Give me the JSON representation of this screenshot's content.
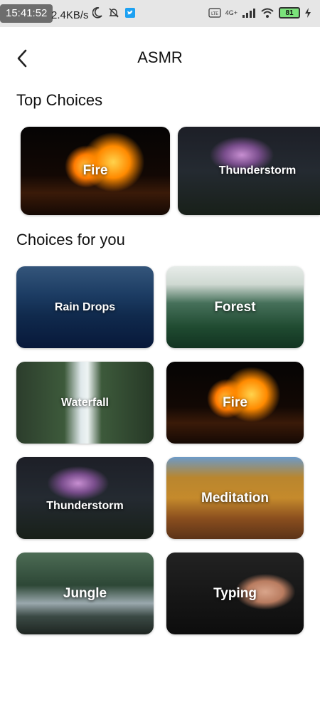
{
  "status_bar": {
    "time": "15:41:52",
    "network_speed": "2.4KB/s",
    "cell_label": "4G+",
    "battery": "81"
  },
  "header": {
    "title": "ASMR"
  },
  "sections": {
    "top_choices_title": "Top Choices",
    "choices_for_you_title": "Choices for you"
  },
  "top_choices": [
    {
      "label": "Fire"
    },
    {
      "label": "Thunderstorm"
    }
  ],
  "choices_for_you": [
    {
      "label": "Rain Drops"
    },
    {
      "label": "Forest"
    },
    {
      "label": "Waterfall"
    },
    {
      "label": "Fire"
    },
    {
      "label": "Thunderstorm"
    },
    {
      "label": "Meditation"
    },
    {
      "label": "Jungle"
    },
    {
      "label": "Typing"
    }
  ]
}
